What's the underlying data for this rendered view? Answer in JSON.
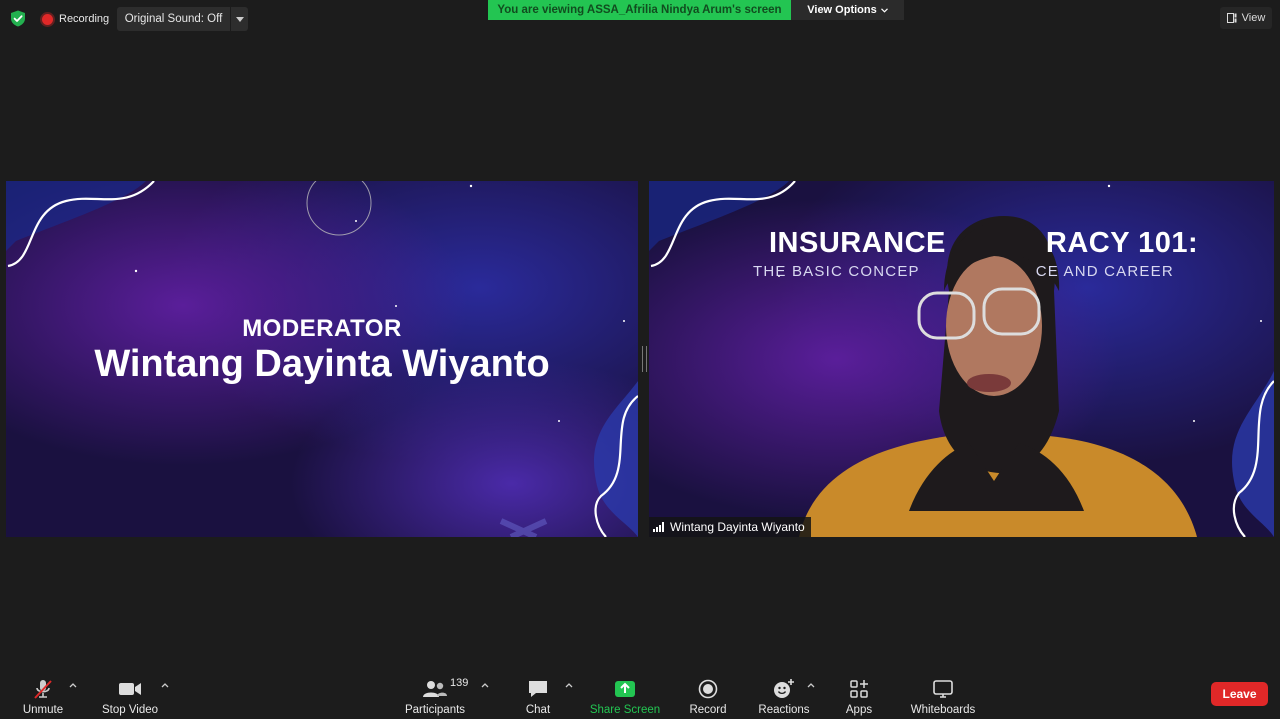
{
  "top_bar": {
    "recording_label": "Recording",
    "original_sound_label": "Original Sound: Off",
    "viewing_banner": "You are viewing ASSA_Afrilia Nindya Arum's screen",
    "view_options_label": "View Options",
    "view_label": "View"
  },
  "tiles": {
    "left": {
      "role_label": "MODERATOR",
      "name": "Wintang Dayinta Wiyanto"
    },
    "right": {
      "title_fragment_left": "INSURANCE",
      "title_fragment_right": "RACY 101:",
      "subtitle_fragment_left": "THE BASIC CONCEP",
      "subtitle_fragment_right": "CE AND CAREER",
      "participant_name": "Wintang Dayinta Wiyanto"
    }
  },
  "toolbar": {
    "unmute_label": "Unmute",
    "stop_video_label": "Stop Video",
    "participants_label": "Participants",
    "participants_count": "139",
    "chat_label": "Chat",
    "share_screen_label": "Share Screen",
    "record_label": "Record",
    "reactions_label": "Reactions",
    "apps_label": "Apps",
    "whiteboards_label": "Whiteboards",
    "leave_label": "Leave"
  },
  "colors": {
    "background": "#1c1c1c",
    "banner_green": "#23c552",
    "share_green": "#23c552",
    "leave_red": "#e02828",
    "recording_red": "#e02828"
  },
  "icons": [
    "shield-icon",
    "recording-dot-icon",
    "caret-down-icon",
    "view-icon",
    "mic-muted-icon",
    "video-camera-icon",
    "participants-icon",
    "chat-bubble-icon",
    "share-screen-icon",
    "record-icon",
    "reactions-icon",
    "apps-icon",
    "whiteboard-icon",
    "signal-icon"
  ]
}
